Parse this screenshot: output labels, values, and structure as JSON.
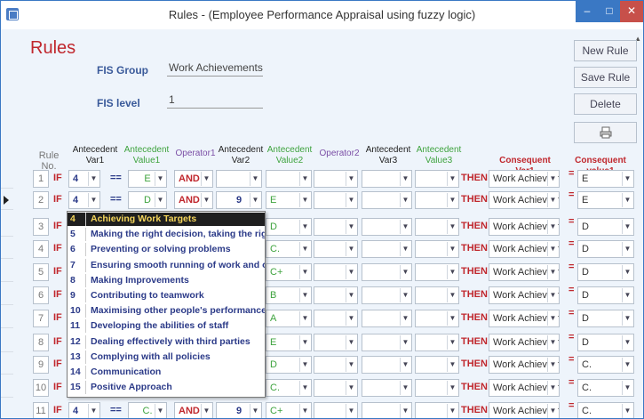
{
  "window": {
    "title": "Rules - (Employee Performance Appraisal using fuzzy logic)"
  },
  "form": {
    "heading": "Rules",
    "fis_group_label": "FIS Group",
    "fis_group_value": "Work Achievements",
    "fis_level_label": "FIS level",
    "fis_level_value": "1"
  },
  "buttons": {
    "new_rule": "New Rule",
    "save_rule": "Save Rule",
    "delete": "Delete"
  },
  "columns": {
    "rule_no": "Rule No.",
    "ant_var1": "Antecedent Var1",
    "ant_val1": "Antecedent Value1",
    "op1": "Operator1",
    "ant_var2": "Antecedent Var2",
    "ant_val2": "Antecedent Value2",
    "op2": "Operator2",
    "ant_var3": "Antecedent Var3",
    "ant_val3": "Antecedent Value3",
    "cons_var1": "Consequent Var1",
    "cons_val1": "Consequent value1"
  },
  "keywords": {
    "if": "IF",
    "then": "THEN",
    "eq": "==",
    "assign": "="
  },
  "rows": [
    {
      "no": "1",
      "var1": "4",
      "val1": "E",
      "op1": "AND",
      "var2": "",
      "val2": "",
      "cons_var": "Work Achievem",
      "cons_val": "E"
    },
    {
      "no": "2",
      "var1": "4",
      "val1": "D",
      "op1": "AND",
      "var2": "9",
      "val2": "E",
      "cons_var": "Work Achievem",
      "cons_val": "E"
    },
    {
      "no": "3",
      "var1": "",
      "val1": "",
      "op1": "",
      "var2": "",
      "val2": "D",
      "cons_var": "Work Achievem",
      "cons_val": "D"
    },
    {
      "no": "4",
      "var1": "",
      "val1": "",
      "op1": "",
      "var2": "",
      "val2": "C.",
      "cons_var": "Work Achievem",
      "cons_val": "D"
    },
    {
      "no": "5",
      "var1": "",
      "val1": "",
      "op1": "",
      "var2": "",
      "val2": "C+",
      "cons_var": "Work Achievem",
      "cons_val": "D"
    },
    {
      "no": "6",
      "var1": "",
      "val1": "",
      "op1": "",
      "var2": "",
      "val2": "B",
      "cons_var": "Work Achievem",
      "cons_val": "D"
    },
    {
      "no": "7",
      "var1": "",
      "val1": "",
      "op1": "",
      "var2": "",
      "val2": "A",
      "cons_var": "Work Achievem",
      "cons_val": "D"
    },
    {
      "no": "8",
      "var1": "",
      "val1": "",
      "op1": "",
      "var2": "",
      "val2": "E",
      "cons_var": "Work Achievem",
      "cons_val": "D"
    },
    {
      "no": "9",
      "var1": "",
      "val1": "",
      "op1": "",
      "var2": "",
      "val2": "D",
      "cons_var": "Work Achievem",
      "cons_val": "C."
    },
    {
      "no": "10",
      "var1": "",
      "val1": "",
      "op1": "",
      "var2": "",
      "val2": "C.",
      "cons_var": "Work Achievem",
      "cons_val": "C."
    },
    {
      "no": "11",
      "var1": "4",
      "val1": "C.",
      "op1": "AND",
      "var2": "9",
      "val2": "C+",
      "cons_var": "Work Achievem",
      "cons_val": "C."
    }
  ],
  "dropdown_options": [
    {
      "num": "4",
      "text": "Achieving Work Targets"
    },
    {
      "num": "5",
      "text": "Making the right decision, taking the right actio"
    },
    {
      "num": "6",
      "text": "Preventing or solving problems"
    },
    {
      "num": "7",
      "text": "Ensuring smooth running of work and operatior"
    },
    {
      "num": "8",
      "text": "Making Improvements"
    },
    {
      "num": "9",
      "text": "Contributing to teamwork"
    },
    {
      "num": "10",
      "text": "Maximising other people's performance"
    },
    {
      "num": "11",
      "text": "Developing the abilities of staff"
    },
    {
      "num": "12",
      "text": "Dealing effectively with third parties"
    },
    {
      "num": "13",
      "text": "Complying with all policies"
    },
    {
      "num": "14",
      "text": "Communication"
    },
    {
      "num": "15",
      "text": "Positive Approach"
    }
  ],
  "colors": {
    "accent_red": "#c0272d",
    "green": "#3ea33e",
    "navy": "#2b3a88",
    "purple": "#7b4fa6"
  }
}
